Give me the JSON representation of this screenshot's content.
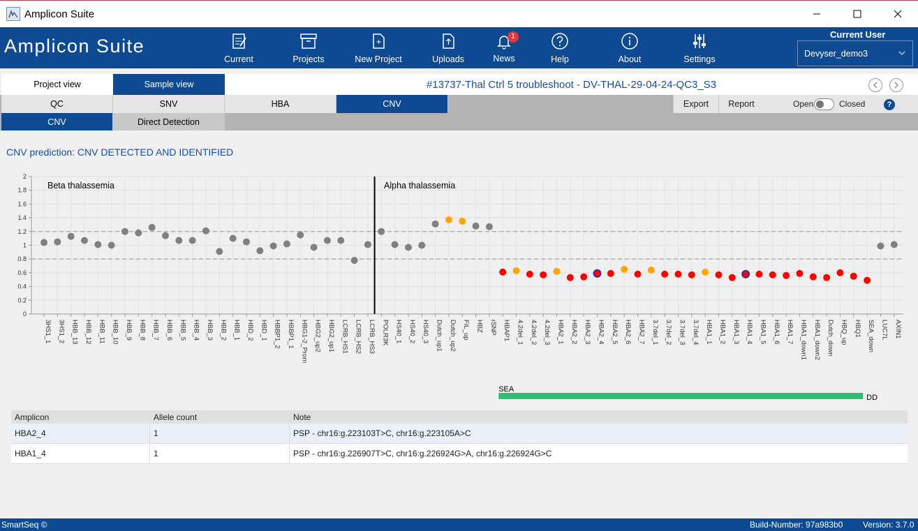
{
  "window": {
    "title": "Amplicon Suite"
  },
  "header": {
    "brand": "Amplicon Suite",
    "nav": [
      {
        "label": "Current",
        "icon": "clipboard-pen-icon"
      },
      {
        "label": "Projects",
        "icon": "archive-box-icon"
      },
      {
        "label": "New Project",
        "icon": "new-file-icon"
      },
      {
        "label": "Uploads",
        "icon": "upload-file-icon"
      },
      {
        "label": "News",
        "icon": "bell-icon",
        "badge": "1"
      },
      {
        "label": "Help",
        "icon": "question-circle-icon"
      },
      {
        "label": "About",
        "icon": "info-circle-icon"
      },
      {
        "label": "Settings",
        "icon": "sliders-icon"
      }
    ],
    "current_user_label": "Current User",
    "current_user": "Devyser_demo3"
  },
  "view_tabs": {
    "project": "Project view",
    "sample": "Sample view",
    "active": "sample"
  },
  "page_title": "#13737-Thal Ctrl 5 troubleshoot - DV-THAL-29-04-24-QC3_S3",
  "analysis_tabs": [
    "QC",
    "SNV",
    "HBA",
    "CNV"
  ],
  "active_analysis_tab": "CNV",
  "toolbar": {
    "export": "Export",
    "report": "Report",
    "open": "Open",
    "closed": "Closed",
    "help": "?"
  },
  "sub_tabs": [
    "CNV",
    "Direct Detection"
  ],
  "active_sub_tab": "CNV",
  "cnv_prediction": "CNV prediction: CNV DETECTED AND IDENTIFIED",
  "colors": {
    "brand_blue": "#0d4a92",
    "normal": "#808080",
    "deleted": "#ff0000",
    "borderline": "#ffa500",
    "highlight_outline": "#3a2fa0",
    "region_bar": "#2bbf77"
  },
  "chart_data": {
    "type": "scatter",
    "ylim": [
      0,
      2
    ],
    "yticks": [
      "0",
      "0.2",
      "0.4",
      "0.6",
      "0.8",
      "1",
      "1.2",
      "1.4",
      "1.6",
      "1.8",
      "2"
    ],
    "reference_lines": [
      0.8,
      1.2
    ],
    "grid": true,
    "sections": [
      {
        "label": "Beta thalassemia"
      },
      {
        "label": "Alpha thalassemia"
      }
    ],
    "categories": [
      "3HS1_1",
      "3HS1_2",
      "HBB_13",
      "HBB_12",
      "HBB_11",
      "HBB_10",
      "HBB_9",
      "HBB_8",
      "HBB_7",
      "HBB_6",
      "HBB_5",
      "HBB_4",
      "HBB_3",
      "HBB_2",
      "HBB_1",
      "HBD_2",
      "HBD_1",
      "HBBP1_2",
      "HBBP1_1",
      "HBG1-2_Prom",
      "HBG2_up2",
      "HBG2_up1",
      "LCRB_HS1",
      "LCRB_HS2",
      "LCRB_HS3",
      "POLR3K",
      "HS40_1",
      "HS40_2",
      "HS40_3",
      "Dutch_up1",
      "Dutch_up2",
      "FIL_up",
      "HBZ",
      "rSNP",
      "HBAP1",
      "4.2del_1",
      "4.2del_2",
      "4.2del_3",
      "HBA2_1",
      "HBA2_2",
      "HBA2_3",
      "HBA2_4",
      "HBA2_5",
      "HBA2_6",
      "HBA2_7",
      "3.7del_1",
      "3.7del_2",
      "3.7del_3",
      "3.7del_4",
      "HBA1_1",
      "HBA1_2",
      "HBA1_3",
      "HBA1_4",
      "HBA1_5",
      "HBA1_6",
      "HBA1_7",
      "HBA1_down1",
      "HBA1_down2",
      "Dutch_down",
      "HBQ_up",
      "HBQ1",
      "SEA_down",
      "LUC7L",
      "AXIN1"
    ],
    "values": [
      1.04,
      1.05,
      1.13,
      1.07,
      1.01,
      1.0,
      1.2,
      1.18,
      1.26,
      1.14,
      1.07,
      1.07,
      1.21,
      0.91,
      1.1,
      1.05,
      0.92,
      0.99,
      1.02,
      1.15,
      0.97,
      1.07,
      1.07,
      0.78,
      1.01,
      1.2,
      1.01,
      0.97,
      1.0,
      1.31,
      1.37,
      1.35,
      1.28,
      1.27,
      0.61,
      0.63,
      0.58,
      0.57,
      0.62,
      0.53,
      0.54,
      0.59,
      0.59,
      0.65,
      0.58,
      0.64,
      0.58,
      0.58,
      0.57,
      0.61,
      0.57,
      0.53,
      0.58,
      0.58,
      0.57,
      0.56,
      0.59,
      0.54,
      0.53,
      0.6,
      0.55,
      0.49,
      0.99,
      1.01
    ],
    "point_status": [
      "n",
      "n",
      "n",
      "n",
      "n",
      "n",
      "n",
      "n",
      "n",
      "n",
      "n",
      "n",
      "n",
      "n",
      "n",
      "n",
      "n",
      "n",
      "n",
      "n",
      "n",
      "n",
      "n",
      "n",
      "n",
      "n",
      "n",
      "n",
      "n",
      "n",
      "o",
      "o",
      "n",
      "n",
      "r",
      "o",
      "r",
      "r",
      "o",
      "r",
      "r",
      "rh",
      "r",
      "o",
      "r",
      "o",
      "r",
      "r",
      "r",
      "o",
      "r",
      "r",
      "rh",
      "r",
      "r",
      "r",
      "r",
      "r",
      "r",
      "r",
      "r",
      "r",
      "n",
      "n"
    ],
    "regions": [
      {
        "name": "SEA",
        "end_label": "DD",
        "from": "HBAP1",
        "to": "SEA_down"
      }
    ]
  },
  "results_table": {
    "headers": [
      "Amplicon",
      "Allele count",
      "Note"
    ],
    "rows": [
      [
        "HBA2_4",
        "1",
        "PSP - chr16:g.223103T>C, chr16:g.223105A>C"
      ],
      [
        "HBA1_4",
        "1",
        "PSP - chr16:g.226907T>C, chr16:g.226924G>A, chr16:g.226924G>C"
      ]
    ]
  },
  "footer": {
    "left": "SmartSeq ©",
    "build": "Build-Number: 97a983b0",
    "version": "Version: 3.7.0"
  }
}
